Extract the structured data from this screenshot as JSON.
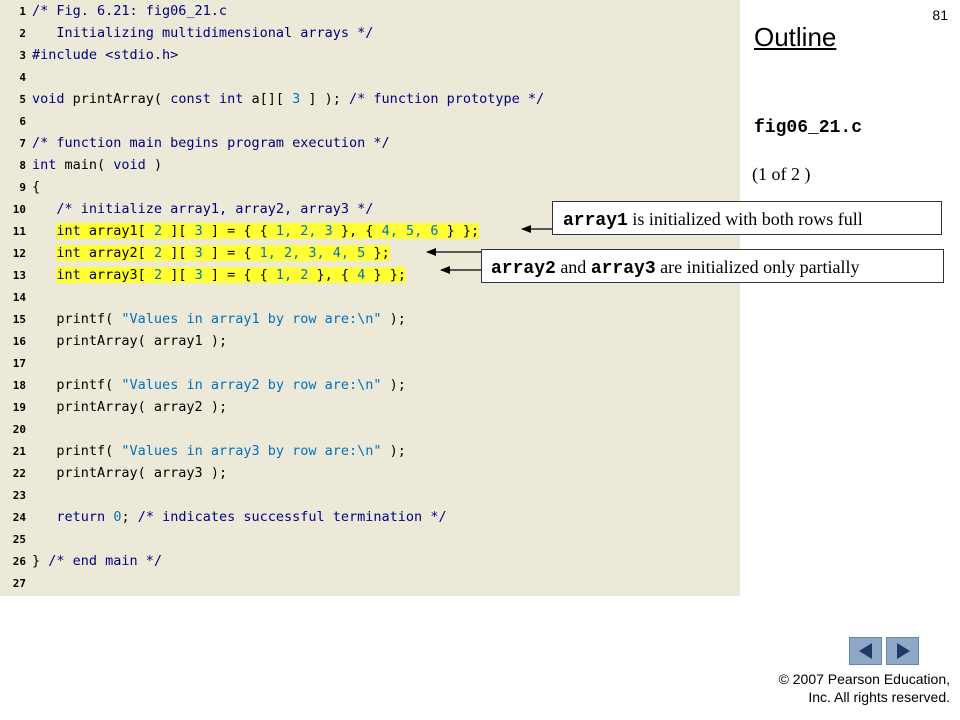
{
  "page_number": "81",
  "outline_title": "Outline",
  "file_name": "fig06_21.c",
  "page_indicator": "(1 of 2 )",
  "code": {
    "line_numbers": [
      "1",
      "2",
      "3",
      "4",
      "5",
      "6",
      "7",
      "8",
      "9",
      "10",
      "11",
      "12",
      "13",
      "14",
      "15",
      "16",
      "17",
      "18",
      "19",
      "20",
      "21",
      "22",
      "23",
      "24",
      "25",
      "26",
      "27"
    ],
    "l1": "/* Fig. 6.21: fig06_21.c",
    "l2": "   Initializing multidimensional arrays */",
    "l3": "#include <stdio.h>",
    "l5_kw1": "void",
    "l5_a": " printArray( ",
    "l5_kw2": "const int",
    "l5_b": " a[][ ",
    "l5_n": "3",
    "l5_c": " ] ); ",
    "l5_cm": "/* function prototype */",
    "l7": "/* function main begins program execution */",
    "l8_kw1": "int",
    "l8_a": " main( ",
    "l8_kw2": "void",
    "l8_b": " )",
    "l9": "{",
    "l10": "/* initialize array1, array2, array3 */",
    "l11_kw": "int",
    "l11_a": " array1[ ",
    "l11_n1": "2",
    "l11_b": " ][ ",
    "l11_n2": "3",
    "l11_c": " ] = { { ",
    "l11_v1": "1, 2, 3",
    "l11_d": " }, { ",
    "l11_v2": "4, 5, 6",
    "l11_e": " } };",
    "l12_kw": "int",
    "l12_a": " array2[ ",
    "l12_n1": "2",
    "l12_b": " ][ ",
    "l12_n2": "3",
    "l12_c": " ] = { ",
    "l12_v": "1, 2, 3, 4, 5",
    "l12_d": " };",
    "l13_kw": "int",
    "l13_a": " array3[ ",
    "l13_n1": "2",
    "l13_b": " ][ ",
    "l13_n2": "3",
    "l13_c": " ] = { { ",
    "l13_v1": "1, 2",
    "l13_d": " }, { ",
    "l13_v2": "4",
    "l13_e": " } };",
    "l15_a": "printf( ",
    "l15_s": "\"Values in array1 by row are:\\n\"",
    "l15_b": " );",
    "l16": "printArray( array1 );",
    "l18_a": "printf( ",
    "l18_s": "\"Values in array2 by row are:\\n\"",
    "l18_b": " );",
    "l19": "printArray( array2 );",
    "l21_a": "printf( ",
    "l21_s": "\"Values in array3 by row are:\\n\"",
    "l21_b": " );",
    "l22": "printArray( array3 );",
    "l24_kw": "return",
    "l24_sp": " ",
    "l24_n": "0",
    "l24_a": "; ",
    "l24_cm": "/* indicates successful termination */",
    "l26_a": "} ",
    "l26_cm": "/* end main */"
  },
  "callouts": {
    "c1_code": "array1",
    "c1_text": " is initialized with both rows full",
    "c2_code1": "array2",
    "c2_and": " and ",
    "c2_code2": "array3",
    "c2_text": " are initialized only partially"
  },
  "nav": {
    "prev_icon": "triangle-left",
    "next_icon": "triangle-right"
  },
  "copyright_line1": "© 2007 Pearson Education,",
  "copyright_line2": "Inc.  All rights reserved.",
  "colors": {
    "code_background": "#ece9d8",
    "highlight": "#ffff33",
    "keyword_comment": "#000080",
    "literal": "#0070c0",
    "nav_button": "#8fa8c8"
  }
}
